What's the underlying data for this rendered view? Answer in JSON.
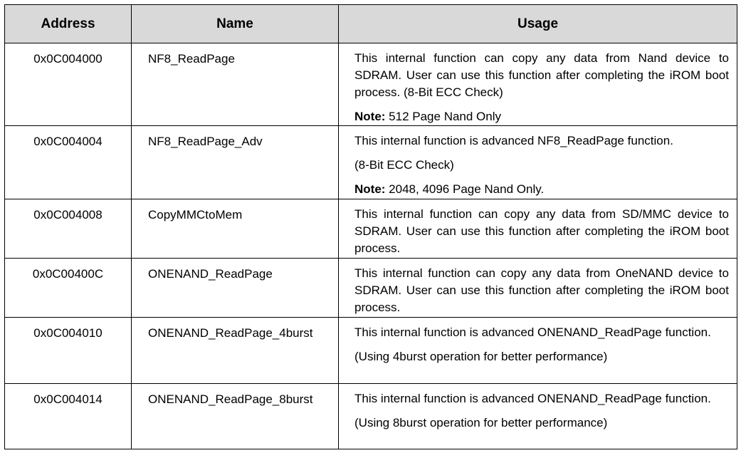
{
  "headers": {
    "address": "Address",
    "name": "Name",
    "usage": "Usage"
  },
  "rows": [
    {
      "address": "0x0C004000",
      "name": "NF8_ReadPage",
      "usage": "This internal function can copy any data from Nand device to SDRAM. User can use this function after completing the iROM boot process. (8-Bit ECC Check)",
      "extra": "",
      "note_label": "Note:",
      "note": " 512 Page Nand Only"
    },
    {
      "address": "0x0C004004",
      "name": "NF8_ReadPage_Adv",
      "usage": "This internal function is advanced NF8_ReadPage function.",
      "extra": "(8-Bit ECC Check)",
      "note_label": "Note:",
      "note": " 2048, 4096 Page Nand Only."
    },
    {
      "address": "0x0C004008",
      "name": "CopyMMCtoMem",
      "usage": "This internal function can copy any data from SD/MMC device to SDRAM. User can use this function after completing the iROM boot process.",
      "extra": "",
      "note_label": "",
      "note": ""
    },
    {
      "address": "0x0C00400C",
      "name": "ONENAND_ReadPage",
      "usage": "This internal function can copy any data from OneNAND device to SDRAM. User can use this function after completing the iROM boot process.",
      "extra": "",
      "note_label": "",
      "note": ""
    },
    {
      "address": "0x0C004010",
      "name": "ONENAND_ReadPage_4burst",
      "usage": "This internal function is advanced ONENAND_ReadPage function.",
      "extra": "(Using 4burst operation for better performance)",
      "note_label": "",
      "note": ""
    },
    {
      "address": "0x0C004014",
      "name": "ONENAND_ReadPage_8burst",
      "usage": "This internal function is advanced ONENAND_ReadPage function.",
      "extra": "(Using 8burst operation for better performance)",
      "note_label": "",
      "note": ""
    }
  ]
}
